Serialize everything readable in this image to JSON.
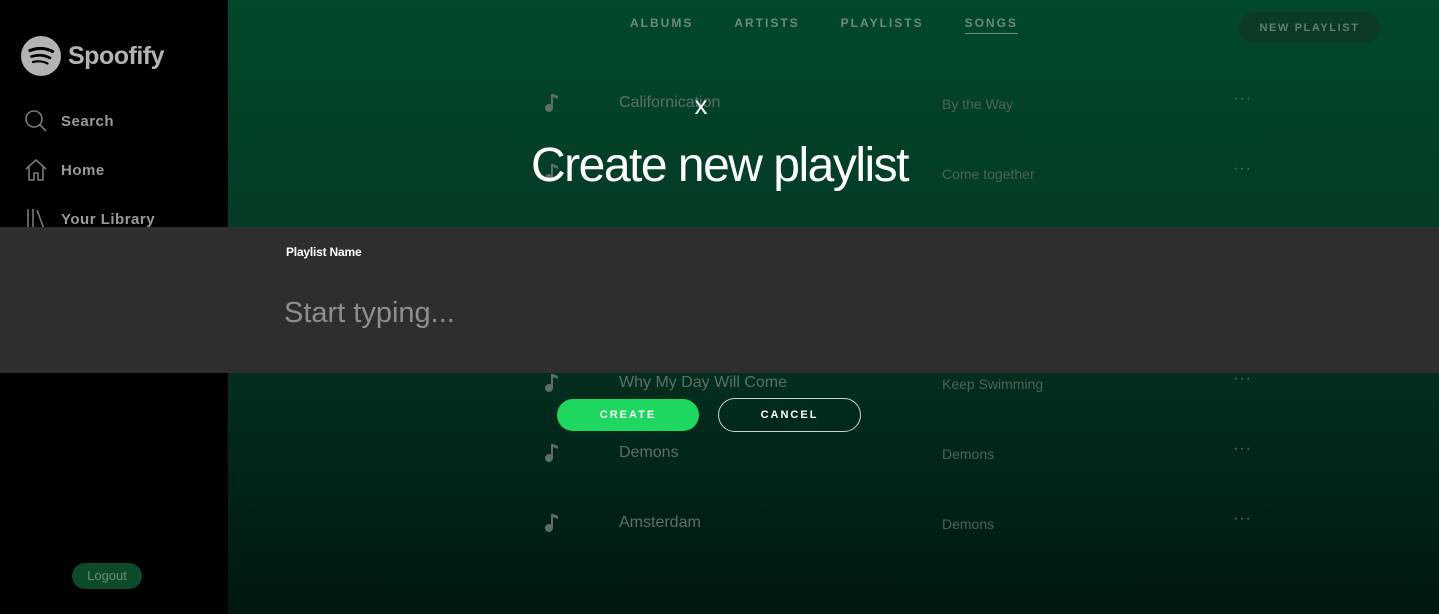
{
  "app": {
    "name": "Spoofify",
    "logo_icon": "spotify-logo-icon"
  },
  "sidebar": {
    "items": [
      {
        "label": "Search",
        "icon": "search-icon"
      },
      {
        "label": "Home",
        "icon": "home-icon"
      },
      {
        "label": "Your Library",
        "icon": "library-icon"
      }
    ],
    "logout_label": "Logout"
  },
  "header": {
    "tabs": [
      {
        "label": "ALBUMS",
        "active": false
      },
      {
        "label": "ARTISTS",
        "active": false
      },
      {
        "label": "PLAYLISTS",
        "active": false
      },
      {
        "label": "SONGS",
        "active": true
      }
    ],
    "new_playlist_label": "NEW PLAYLIST"
  },
  "songs": [
    {
      "title": "Californication",
      "album": "By the Way",
      "more": "···"
    },
    {
      "title": "",
      "album": "Come together",
      "more": "···"
    },
    {
      "title": "Why My Day Will Come",
      "album": "Keep Swimming",
      "more": "···"
    },
    {
      "title": "Demons",
      "album": "Demons",
      "more": "···"
    },
    {
      "title": "Amsterdam",
      "album": "Demons",
      "more": "···"
    }
  ],
  "modal": {
    "close_label": "x",
    "title": "Create new playlist",
    "field_label": "Playlist Name",
    "field_value": "",
    "field_placeholder": "Start typing...",
    "create_label": "CREATE",
    "cancel_label": "CANCEL"
  },
  "colors": {
    "accent": "#1ed760",
    "input_band": "#2e2e2e",
    "main_bg_top": "#02482a"
  }
}
